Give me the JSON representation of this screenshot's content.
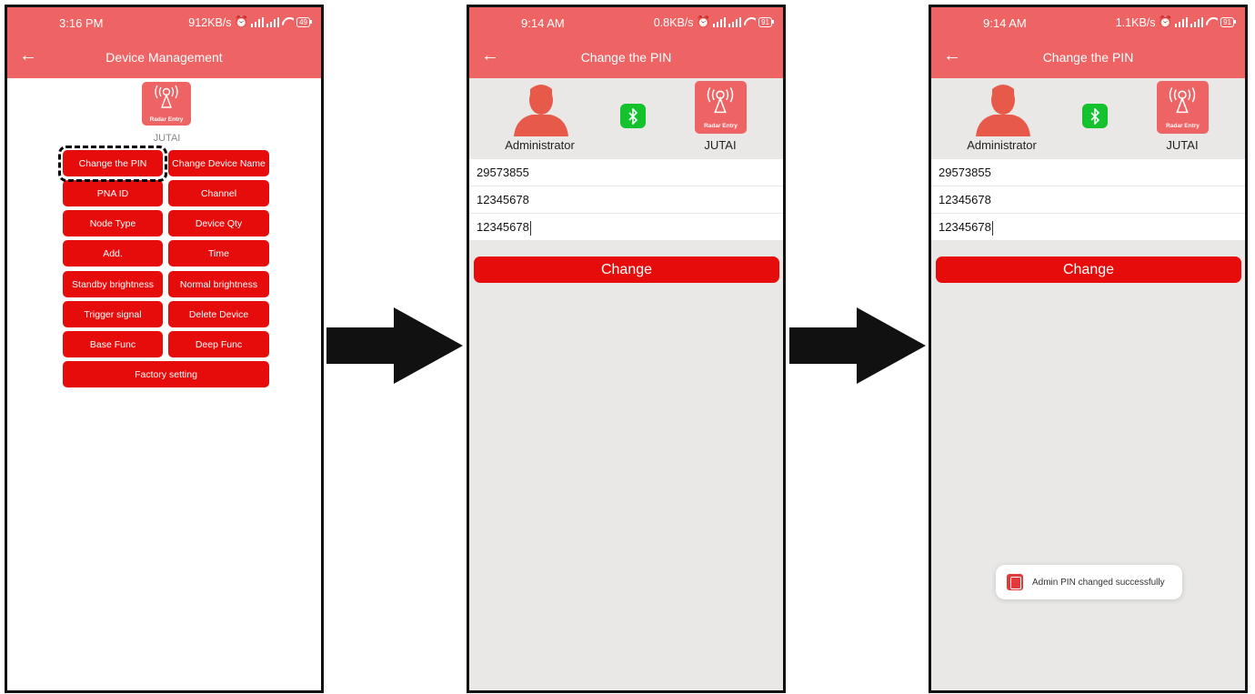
{
  "colors": {
    "primary": "#ee6363",
    "button": "#e60c0c",
    "bluetooth": "#13c22d",
    "screen_bg": "#e9e8e6"
  },
  "screen1": {
    "status": {
      "time": "3:16 PM",
      "speed": "912KB/s",
      "battery": "49"
    },
    "title": "Device Management",
    "back_icon": "arrow-left-icon",
    "logo_label": "Radar Entry",
    "device_name": "JUTAI",
    "buttons": {
      "change_pin": "Change the PIN",
      "change_device_name": "Change Device Name",
      "pna_id": "PNA ID",
      "channel": "Channel",
      "node_type": "Node Type",
      "device_qty": "Device Qty",
      "add": "Add.",
      "time": "Time",
      "standby_brightness": "Standby brightness",
      "normal_brightness": "Normal brightness",
      "trigger_signal": "Trigger signal",
      "delete_device": "Delete Device",
      "base_func": "Base Func",
      "deep_func": "Deep Func",
      "factory_setting": "Factory setting"
    }
  },
  "screen2": {
    "status": {
      "time": "9:14 AM",
      "speed": "0.8KB/s",
      "battery": "91"
    },
    "title": "Change the PIN",
    "admin_label": "Administrator",
    "device_label": "JUTAI",
    "logo_label": "Radar Entry",
    "fields": {
      "current_pin": "29573855",
      "new_pin": "12345678",
      "confirm_pin": "12345678"
    },
    "change_label": "Change"
  },
  "screen3": {
    "status": {
      "time": "9:14 AM",
      "speed": "1.1KB/s",
      "battery": "91"
    },
    "title": "Change the PIN",
    "admin_label": "Administrator",
    "device_label": "JUTAI",
    "logo_label": "Radar Entry",
    "fields": {
      "current_pin": "29573855",
      "new_pin": "12345678",
      "confirm_pin": "12345678"
    },
    "change_label": "Change",
    "toast": "Admin PIN changed successfully"
  }
}
